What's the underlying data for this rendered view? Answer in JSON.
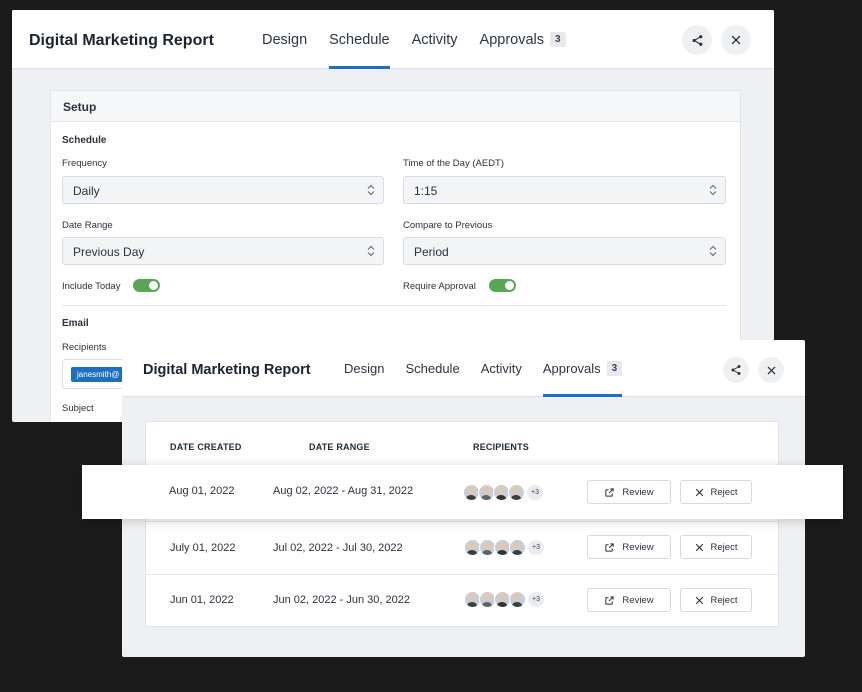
{
  "back_window": {
    "title": "Digital Marketing Report",
    "tabs": [
      {
        "label": "Design"
      },
      {
        "label": "Schedule"
      },
      {
        "label": "Activity"
      },
      {
        "label": "Approvals",
        "badge": "3"
      }
    ],
    "active_tab": "Schedule",
    "setup": {
      "heading": "Setup",
      "schedule_heading": "Schedule",
      "frequency_label": "Frequency",
      "frequency_value": "Daily",
      "time_label": "Time of the Day (AEDT)",
      "time_value": "1:15",
      "date_range_label": "Date Range",
      "date_range_value": "Previous Day",
      "compare_label": "Compare to Previous",
      "compare_value": "Period",
      "include_today_label": "Include Today",
      "include_today_on": true,
      "require_approval_label": "Require Approval",
      "require_approval_on": true,
      "email_heading": "Email",
      "recipients_label": "Recipients",
      "recipient_chip": "janesmith@",
      "subject_label": "Subject"
    }
  },
  "front_window": {
    "title": "Digital Marketing Report",
    "tabs": [
      {
        "label": "Design"
      },
      {
        "label": "Schedule"
      },
      {
        "label": "Activity"
      },
      {
        "label": "Approvals",
        "badge": "3"
      }
    ],
    "active_tab": "Approvals",
    "table": {
      "headers": {
        "date_created": "DATE CREATED",
        "date_range": "DATE RANGE",
        "recipients": "RECIPIENTS"
      },
      "rows": [
        {
          "date_created": "Aug 01, 2022",
          "date_range": "Aug 02, 2022 - Aug 31, 2022",
          "recipients_more": "+3",
          "review": "Review",
          "reject": "Reject"
        },
        {
          "date_created": "July 01, 2022",
          "date_range": "Jul 02, 2022 - Jul 30, 2022",
          "recipients_more": "+3",
          "review": "Review",
          "reject": "Reject"
        },
        {
          "date_created": "Jun 01, 2022",
          "date_range": "Jun 02, 2022 - Jun 30, 2022",
          "recipients_more": "+3",
          "review": "Review",
          "reject": "Reject"
        }
      ]
    }
  },
  "icons": {
    "share": "share-icon",
    "close": "close-icon",
    "chevron": "chevron-updown-icon",
    "review": "external-link-icon",
    "reject": "x-icon"
  },
  "colors": {
    "background": "#1b1b1b",
    "accent": "#1c6fc1",
    "toggle_on": "#5aa657"
  }
}
